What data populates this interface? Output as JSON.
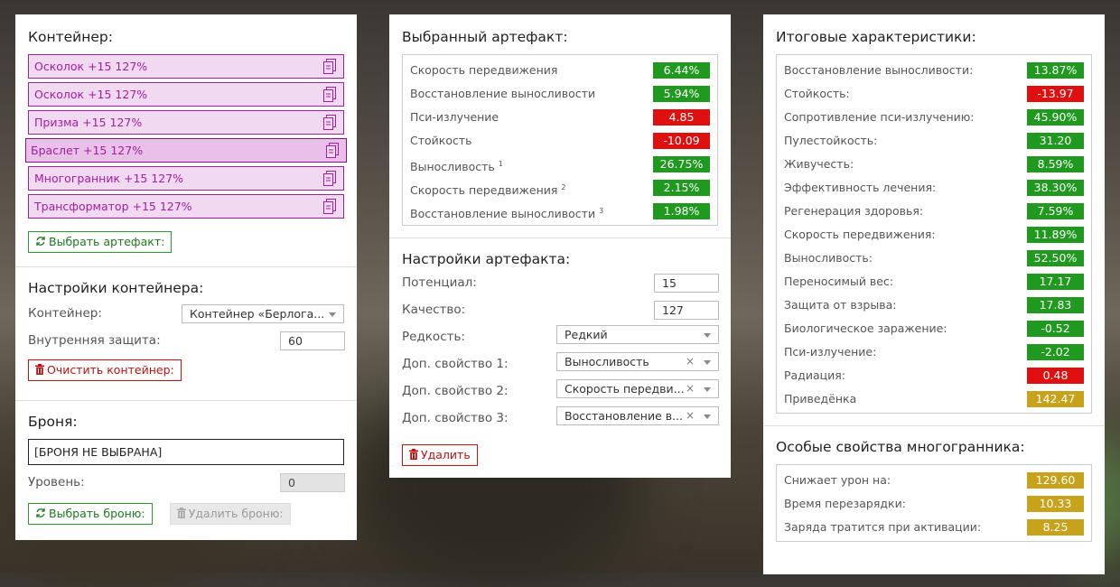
{
  "container_panel": {
    "title": "Контейнер:",
    "items": [
      {
        "label": "Осколок +15 127%"
      },
      {
        "label": "Осколок +15 127%"
      },
      {
        "label": "Призма +15 127%"
      },
      {
        "label": "Браслет +15 127%"
      },
      {
        "label": "Многогранник +15 127%"
      },
      {
        "label": "Трансформатор +15 127%"
      }
    ],
    "select_button": "Выбрать артефакт:",
    "settings_title": "Настройки контейнера:",
    "container_label": "Контейнер:",
    "container_value": "Контейнер «Берлога...",
    "protection_label": "Внутренняя защита:",
    "protection_value": "60",
    "clear_button": "Очистить контейнер:",
    "armor_title": "Броня:",
    "armor_value": "[БРОНЯ НЕ ВЫБРАНА]",
    "level_label": "Уровень:",
    "level_value": "0",
    "select_armor_button": "Выбрать броню:",
    "remove_armor_button": "Удалить броню:"
  },
  "artifact_panel": {
    "title": "Выбранный артефакт:",
    "stats": [
      {
        "label": "Скорость передвижения",
        "sup": "",
        "value": "6.44%",
        "color": "green"
      },
      {
        "label": "Восстановление выносливости",
        "sup": "",
        "value": "5.94%",
        "color": "green"
      },
      {
        "label": "Пси-излучение",
        "sup": "",
        "value": "4.85",
        "color": "red"
      },
      {
        "label": "Стойкость",
        "sup": "",
        "value": "-10.09",
        "color": "red"
      },
      {
        "label": "Выносливость",
        "sup": "1",
        "value": "26.75%",
        "color": "green"
      },
      {
        "label": "Скорость передвижения",
        "sup": "2",
        "value": "2.15%",
        "color": "green"
      },
      {
        "label": "Восстановление выносливости",
        "sup": "3",
        "value": "1.98%",
        "color": "green"
      }
    ],
    "settings_title": "Настройки артефакта:",
    "potential_label": "Потенциал:",
    "potential_value": "15",
    "quality_label": "Качество:",
    "quality_value": "127",
    "rarity_label": "Редкость:",
    "rarity_value": "Редкий",
    "extra1_label": "Доп. свойство 1:",
    "extra1_value": "Выносливость",
    "extra2_label": "Доп. свойство 2:",
    "extra2_value": "Скорость передви...",
    "extra3_label": "Доп. свойство 3:",
    "extra3_value": "Восстановление в...",
    "delete_button": "Удалить"
  },
  "totals_panel": {
    "title": "Итоговые характеристики:",
    "stats": [
      {
        "label": "Восстановление выносливости:",
        "value": "13.87%",
        "color": "green"
      },
      {
        "label": "Стойкость:",
        "value": "-13.97",
        "color": "red"
      },
      {
        "label": "Сопротивление пси-излучению:",
        "value": "45.90%",
        "color": "green"
      },
      {
        "label": "Пулестойкость:",
        "value": "31.20",
        "color": "green"
      },
      {
        "label": "Живучесть:",
        "value": "8.59%",
        "color": "green"
      },
      {
        "label": "Эффективность лечения:",
        "value": "38.30%",
        "color": "green"
      },
      {
        "label": "Регенерация здоровья:",
        "value": "7.59%",
        "color": "green"
      },
      {
        "label": "Скорость передвижения:",
        "value": "11.89%",
        "color": "green"
      },
      {
        "label": "Выносливость:",
        "value": "52.50%",
        "color": "green"
      },
      {
        "label": "Переносимый вес:",
        "value": "17.17",
        "color": "green"
      },
      {
        "label": "Защита от взрыва:",
        "value": "17.83",
        "color": "green"
      },
      {
        "label": "Биологическое заражение:",
        "value": "-0.52",
        "color": "green"
      },
      {
        "label": "Пси-излучение:",
        "value": "-2.02",
        "color": "green"
      },
      {
        "label": "Радиация:",
        "value": "0.48",
        "color": "red"
      },
      {
        "label": "Приведёнка",
        "value": "142.47",
        "color": "gold"
      }
    ],
    "special_title": "Особые свойства многогранника:",
    "special_stats": [
      {
        "label": "Снижает урон на:",
        "value": "129.60",
        "color": "gold"
      },
      {
        "label": "Время перезарядки:",
        "value": "10.33",
        "color": "gold"
      },
      {
        "label": "Заряда тратится при активации:",
        "value": "8.25",
        "color": "gold"
      }
    ]
  },
  "colors": {
    "green": "#1f9a1f",
    "red": "#e01010",
    "gold": "#c9a21c",
    "item_border": "#a020a0",
    "item_bg": "#f2d9f2"
  }
}
